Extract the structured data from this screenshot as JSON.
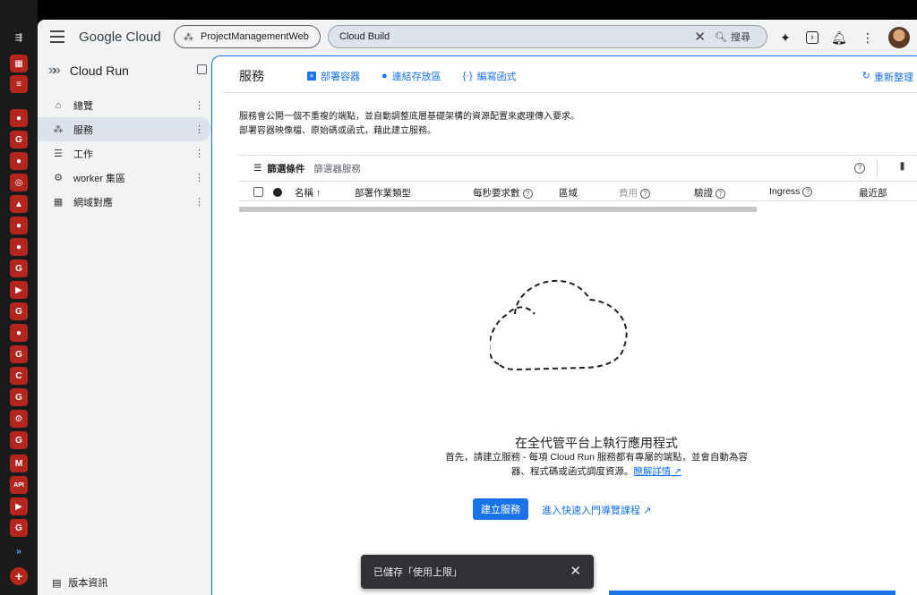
{
  "browser_tabs": {
    "icons": [
      "tab-list-icon",
      "apps-icon",
      "search-tabs-icon",
      "github-icon",
      "google-icon",
      "github-icon",
      "globe-icon",
      "drive-icon",
      "github-icon",
      "github-icon",
      "google-icon",
      "youtube-icon",
      "google-icon",
      "github-icon",
      "g-icon",
      "c-icon",
      "g-icon",
      "settings-icon",
      "google-icon",
      "mk-icon",
      "api-icon",
      "youtube-icon",
      "google-icon",
      "cloud-run-icon",
      "new-tab-icon"
    ]
  },
  "topbar": {
    "logo": "Google Cloud",
    "project": "ProjectManagementWeb",
    "search_value": "Cloud Build",
    "search_button": "搜尋"
  },
  "sidebar": {
    "product": "Cloud Run",
    "items": [
      {
        "label": "總覽",
        "icon": "home-icon"
      },
      {
        "label": "服務",
        "icon": "services-icon",
        "active": true
      },
      {
        "label": "工作",
        "icon": "list-icon"
      },
      {
        "label": "worker 集區",
        "icon": "workers-icon"
      },
      {
        "label": "網域對應",
        "icon": "domain-icon"
      }
    ],
    "release_notes": "版本資訊"
  },
  "main": {
    "title": "服務",
    "actions": [
      "部署容器",
      "連結存放區",
      "編寫函式"
    ],
    "refresh": "重新整理",
    "description_line1": "服務會公開一個不重複的端點，並自動調整底層基礎架構的資源配置來處理傳入要求。",
    "description_line2": "部署容器映像檔、原始碼或函式，藉此建立服務。",
    "filter_label": "篩選條件",
    "filter_placeholder": "篩選器服務",
    "columns": [
      "名稱",
      "部署作業類型",
      "每秒要求數",
      "區域",
      "費用",
      "驗證",
      "Ingress",
      "最近部"
    ],
    "empty_title": "在全代管平台上執行應用程式",
    "empty_desc_line1": "首先，請建立服務 - 每項 Cloud Run 服務都有專屬的端點，並會自動為容",
    "empty_desc_line2": "器、程式碼或函式調度資源。",
    "learn_more": "瞭解詳情",
    "create_button": "建立服務",
    "tour_link": "進入快速入門導覽課程"
  },
  "snackbar": {
    "message": "已儲存「使用上限」"
  },
  "colors": {
    "accent": "#1a73e8",
    "active_nav": "#dde3ea"
  }
}
